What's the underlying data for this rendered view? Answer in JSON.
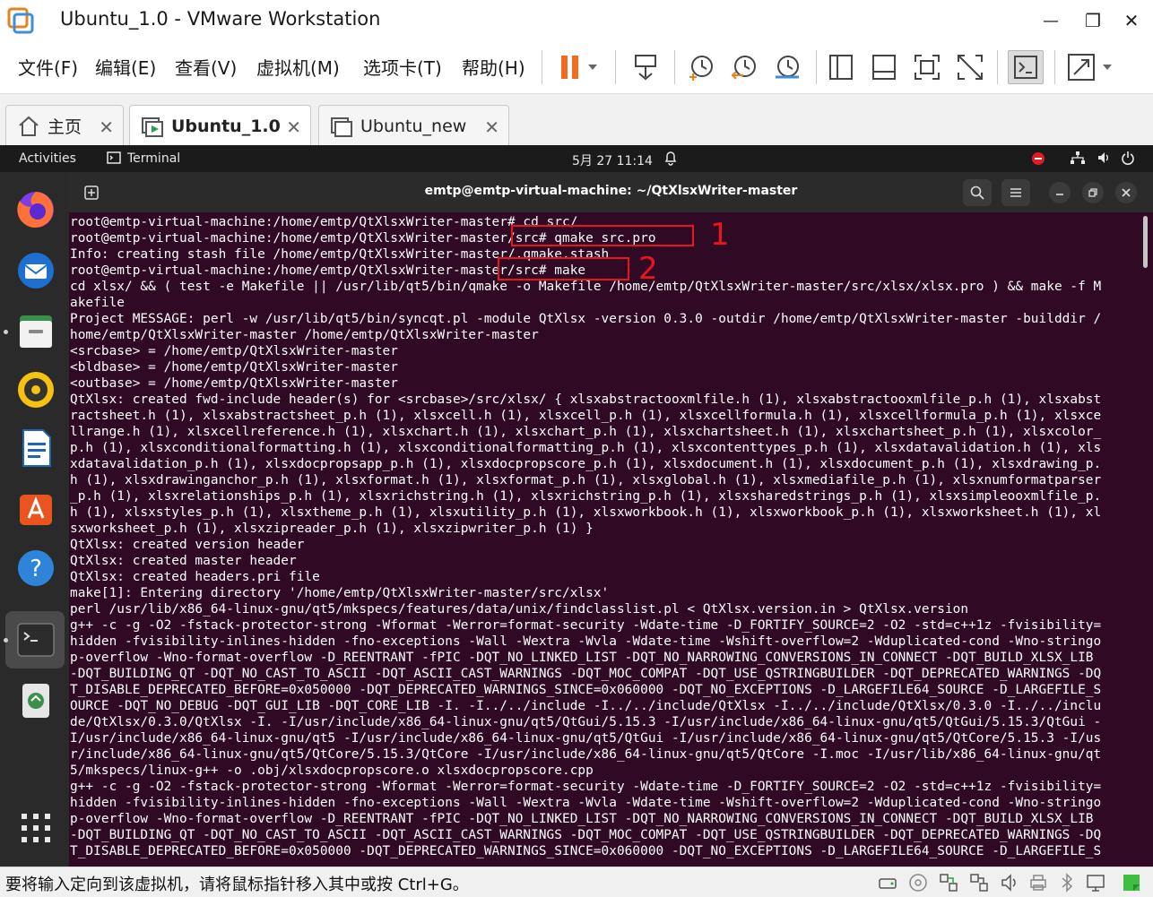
{
  "window": {
    "title": "Ubuntu_1.0 - VMware Workstation",
    "minimize_glyph": "—",
    "maximize_glyph": "❐",
    "close_glyph": "✕"
  },
  "menu": {
    "items": [
      "文件(F)",
      "编辑(E)",
      "查看(V)",
      "虚拟机(M)",
      "选项卡(T)",
      "帮助(H)"
    ]
  },
  "tabs": [
    {
      "label": "主页",
      "icon": "home-icon"
    },
    {
      "label": "Ubuntu_1.0",
      "icon": "vm-running-icon"
    },
    {
      "label": "Ubuntu_new",
      "icon": "vm-icon"
    }
  ],
  "tab_close_glyph": "✕",
  "guest_topbar": {
    "activities": "Activities",
    "app": "Terminal",
    "clock": "5月 27  11:14"
  },
  "terminal": {
    "title": "emtp@emtp-virtual-machine: ~/QtXlsxWriter-master",
    "lines": [
      "root@emtp-virtual-machine:/home/emtp/QtXlsxWriter-master# cd src/",
      "root@emtp-virtual-machine:/home/emtp/QtXlsxWriter-master/src# qmake src.pro",
      "Info: creating stash file /home/emtp/QtXlsxWriter-master/.qmake.stash",
      "root@emtp-virtual-machine:/home/emtp/QtXlsxWriter-master/src# make",
      "cd xlsx/ && ( test -e Makefile || /usr/lib/qt5/bin/qmake -o Makefile /home/emtp/QtXlsxWriter-master/src/xlsx/xlsx.pro ) && make -f M",
      "akefile",
      "Project MESSAGE: perl -w /usr/lib/qt5/bin/syncqt.pl -module QtXlsx -version 0.3.0 -outdir /home/emtp/QtXlsxWriter-master -builddir /",
      "home/emtp/QtXlsxWriter-master /home/emtp/QtXlsxWriter-master",
      "<srcbase> = /home/emtp/QtXlsxWriter-master",
      "<bldbase> = /home/emtp/QtXlsxWriter-master",
      "<outbase> = /home/emtp/QtXlsxWriter-master",
      "QtXlsx: created fwd-include header(s) for <srcbase>/src/xlsx/ { xlsxabstractooxmlfile.h (1), xlsxabstractooxmlfile_p.h (1), xlsxabst",
      "ractsheet.h (1), xlsxabstractsheet_p.h (1), xlsxcell.h (1), xlsxcell_p.h (1), xlsxcellformula.h (1), xlsxcellformula_p.h (1), xlsxce",
      "llrange.h (1), xlsxcellreference.h (1), xlsxchart.h (1), xlsxchart_p.h (1), xlsxchartsheet.h (1), xlsxchartsheet_p.h (1), xlsxcolor_",
      "p.h (1), xlsxconditionalformatting.h (1), xlsxconditionalformatting_p.h (1), xlsxcontenttypes_p.h (1), xlsxdatavalidation.h (1), xls",
      "xdatavalidation_p.h (1), xlsxdocpropsapp_p.h (1), xlsxdocpropscore_p.h (1), xlsxdocument.h (1), xlsxdocument_p.h (1), xlsxdrawing_p.",
      "h (1), xlsxdrawinganchor_p.h (1), xlsxformat.h (1), xlsxformat_p.h (1), xlsxglobal.h (1), xlsxmediafile_p.h (1), xlsxnumformatparser",
      "_p.h (1), xlsxrelationships_p.h (1), xlsxrichstring.h (1), xlsxrichstring_p.h (1), xlsxsharedstrings_p.h (1), xlsxsimpleooxmlfile_p.",
      "h (1), xlsxstyles_p.h (1), xlsxtheme_p.h (1), xlsxutility_p.h (1), xlsxworkbook.h (1), xlsxworkbook_p.h (1), xlsxworksheet.h (1), xl",
      "sxworksheet_p.h (1), xlsxzipreader_p.h (1), xlsxzipwriter_p.h (1) }",
      "QtXlsx: created version header",
      "QtXlsx: created master header",
      "QtXlsx: created headers.pri file",
      "make[1]: Entering directory '/home/emtp/QtXlsxWriter-master/src/xlsx'",
      "perl /usr/lib/x86_64-linux-gnu/qt5/mkspecs/features/data/unix/findclasslist.pl < QtXlsx.version.in > QtXlsx.version",
      "g++ -c -g -O2 -fstack-protector-strong -Wformat -Werror=format-security -Wdate-time -D_FORTIFY_SOURCE=2 -O2 -std=c++1z -fvisibility=",
      "hidden -fvisibility-inlines-hidden -fno-exceptions -Wall -Wextra -Wvla -Wdate-time -Wshift-overflow=2 -Wduplicated-cond -Wno-stringo",
      "p-overflow -Wno-format-overflow -D_REENTRANT -fPIC -DQT_NO_LINKED_LIST -DQT_NO_NARROWING_CONVERSIONS_IN_CONNECT -DQT_BUILD_XLSX_LIB",
      "-DQT_BUILDING_QT -DQT_NO_CAST_TO_ASCII -DQT_ASCII_CAST_WARNINGS -DQT_MOC_COMPAT -DQT_USE_QSTRINGBUILDER -DQT_DEPRECATED_WARNINGS -DQ",
      "T_DISABLE_DEPRECATED_BEFORE=0x050000 -DQT_DEPRECATED_WARNINGS_SINCE=0x060000 -DQT_NO_EXCEPTIONS -D_LARGEFILE64_SOURCE -D_LARGEFILE_S",
      "OURCE -DQT_NO_DEBUG -DQT_GUI_LIB -DQT_CORE_LIB -I. -I../../include -I../../include/QtXlsx -I../../include/QtXlsx/0.3.0 -I../../inclu",
      "de/QtXlsx/0.3.0/QtXlsx -I. -I/usr/include/x86_64-linux-gnu/qt5/QtGui/5.15.3 -I/usr/include/x86_64-linux-gnu/qt5/QtGui/5.15.3/QtGui -",
      "I/usr/include/x86_64-linux-gnu/qt5 -I/usr/include/x86_64-linux-gnu/qt5/QtGui -I/usr/include/x86_64-linux-gnu/qt5/QtCore/5.15.3 -I/us",
      "r/include/x86_64-linux-gnu/qt5/QtCore/5.15.3/QtCore -I/usr/include/x86_64-linux-gnu/qt5/QtCore -I.moc -I/usr/lib/x86_64-linux-gnu/qt",
      "5/mkspecs/linux-g++ -o .obj/xlsxdocpropscore.o xlsxdocpropscore.cpp",
      "g++ -c -g -O2 -fstack-protector-strong -Wformat -Werror=format-security -Wdate-time -D_FORTIFY_SOURCE=2 -O2 -std=c++1z -fvisibility=",
      "hidden -fvisibility-inlines-hidden -fno-exceptions -Wall -Wextra -Wvla -Wdate-time -Wshift-overflow=2 -Wduplicated-cond -Wno-stringo",
      "p-overflow -Wno-format-overflow -D_REENTRANT -fPIC -DQT_NO_LINKED_LIST -DQT_NO_NARROWING_CONVERSIONS_IN_CONNECT -DQT_BUILD_XLSX_LIB",
      "-DQT_BUILDING_QT -DQT_NO_CAST_TO_ASCII -DQT_ASCII_CAST_WARNINGS -DQT_MOC_COMPAT -DQT_USE_QSTRINGBUILDER -DQT_DEPRECATED_WARNINGS -DQ",
      "T_DISABLE_DEPRECATED_BEFORE=0x050000 -DQT_DEPRECATED_WARNINGS_SINCE=0x060000 -DQT_NO_EXCEPTIONS -D_LARGEFILE64_SOURCE -D_LARGEFILE_S"
    ]
  },
  "annotations": [
    "1",
    "2"
  ],
  "statusbar": {
    "message": "要将输入定向到该虚拟机，请将鼠标指针移入其中或按 Ctrl+G。"
  },
  "colors": {
    "terminal_bg": "#300a24",
    "annotation": "#e8141e",
    "pause_orange": "#f26b21"
  }
}
